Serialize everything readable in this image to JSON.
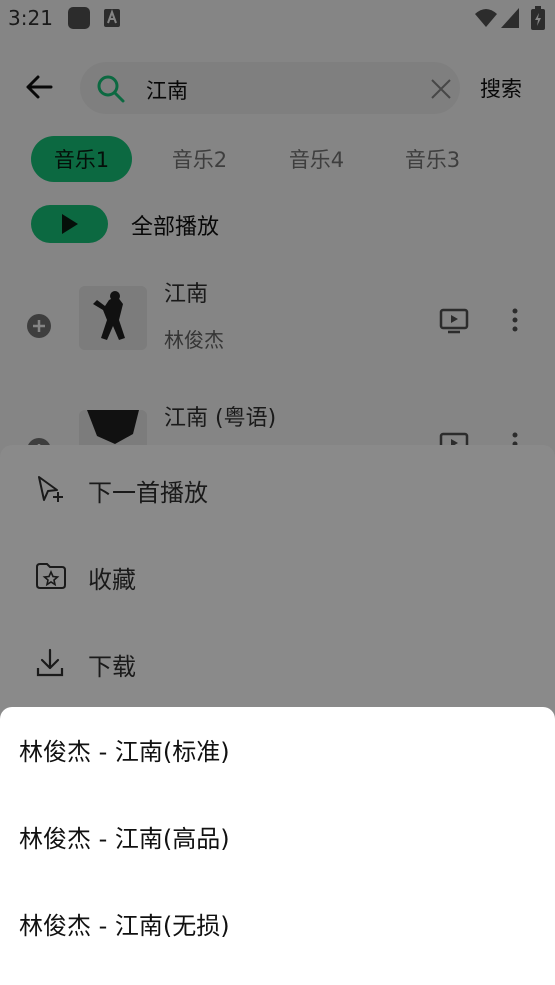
{
  "status_bar": {
    "time": "3:21",
    "icons": [
      "app-icon",
      "a-icon",
      "wifi-icon",
      "signal-icon",
      "battery-icon"
    ]
  },
  "search": {
    "value": "江南",
    "button_label": "搜索"
  },
  "tabs": [
    {
      "label": "音乐1",
      "active": true
    },
    {
      "label": "音乐2",
      "active": false
    },
    {
      "label": "音乐4",
      "active": false
    },
    {
      "label": "音乐3",
      "active": false
    }
  ],
  "play_all": {
    "label": "全部播放"
  },
  "songs": [
    {
      "title": "江南",
      "artist": "林俊杰"
    },
    {
      "title": "江南 (粤语)",
      "artist": ""
    }
  ],
  "action_sheet": {
    "items": [
      {
        "label": "下一首播放",
        "icon": "play-next-icon"
      },
      {
        "label": "收藏",
        "icon": "folder-star-icon"
      },
      {
        "label": "下载",
        "icon": "download-icon"
      }
    ]
  },
  "quality_popup": {
    "items": [
      {
        "label": "林俊杰 - 江南(标准)"
      },
      {
        "label": "林俊杰 - 江南(高品)"
      },
      {
        "label": "林俊杰 - 江南(无损)"
      }
    ]
  },
  "colors": {
    "accent": "#18c97e",
    "overlay": "rgba(0,0,0,0.48)",
    "sheet": "#8a8a8a",
    "popup": "#ffffff"
  }
}
